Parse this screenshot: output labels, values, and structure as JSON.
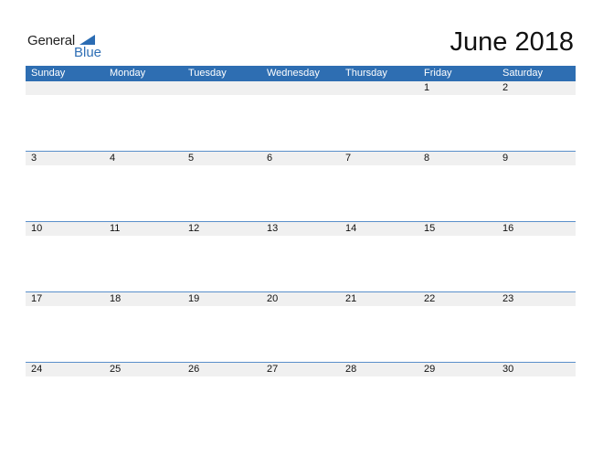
{
  "logo": {
    "word1": "General",
    "word2": "Blue",
    "accent": "#2b6cb3"
  },
  "title": "June 2018",
  "header_color": "#2e6eb2",
  "days": [
    "Sunday",
    "Monday",
    "Tuesday",
    "Wednesday",
    "Thursday",
    "Friday",
    "Saturday"
  ],
  "weeks": [
    [
      "",
      "",
      "",
      "",
      "",
      "1",
      "2"
    ],
    [
      "3",
      "4",
      "5",
      "6",
      "7",
      "8",
      "9"
    ],
    [
      "10",
      "11",
      "12",
      "13",
      "14",
      "15",
      "16"
    ],
    [
      "17",
      "18",
      "19",
      "20",
      "21",
      "22",
      "23"
    ],
    [
      "24",
      "25",
      "26",
      "27",
      "28",
      "29",
      "30"
    ]
  ]
}
